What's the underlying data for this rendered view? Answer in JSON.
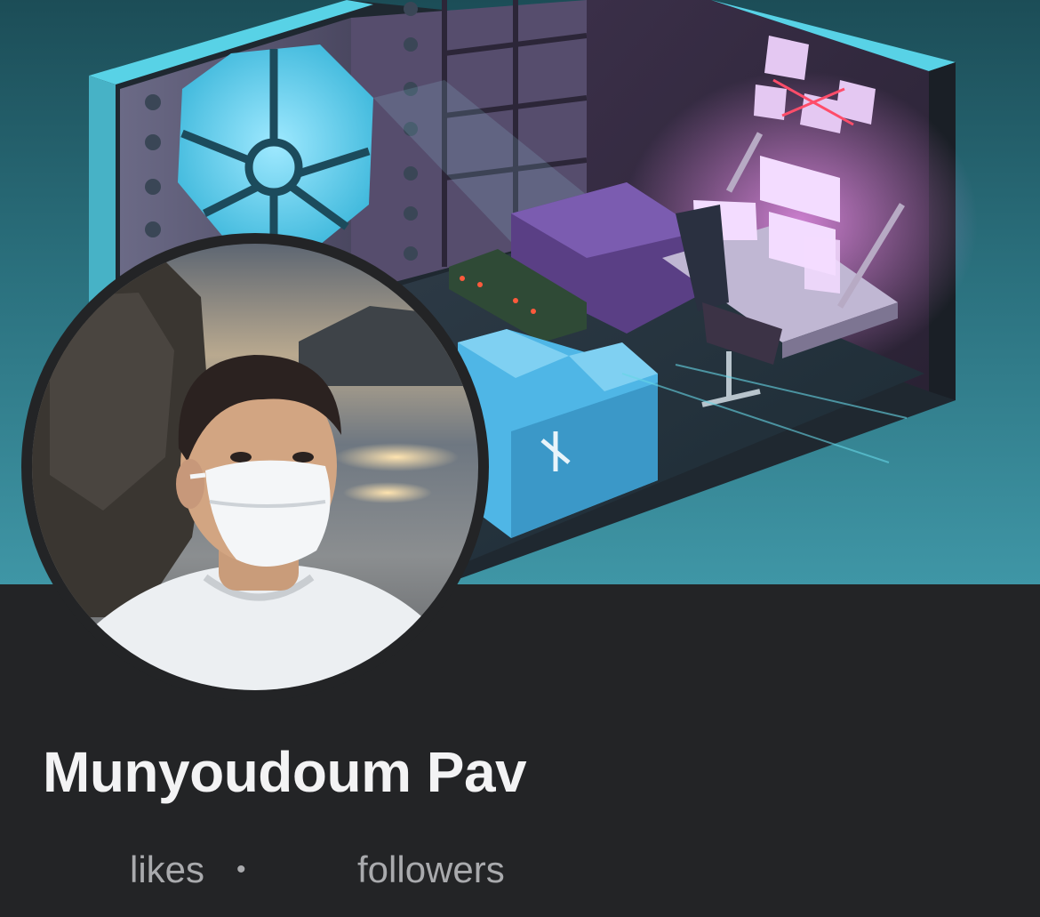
{
  "profile": {
    "name": "Munyoudoum Pav",
    "stats": {
      "likes_label": "likes",
      "separator": "•",
      "followers_label": "followers"
    }
  },
  "colors": {
    "background": "#232426",
    "name_text": "#f3f3f4",
    "stat_text": "#a9aaad",
    "cover_teal": "#2a6f7c"
  },
  "icons": {
    "cover": "isometric-room-illustration",
    "avatar": "profile-photo"
  }
}
